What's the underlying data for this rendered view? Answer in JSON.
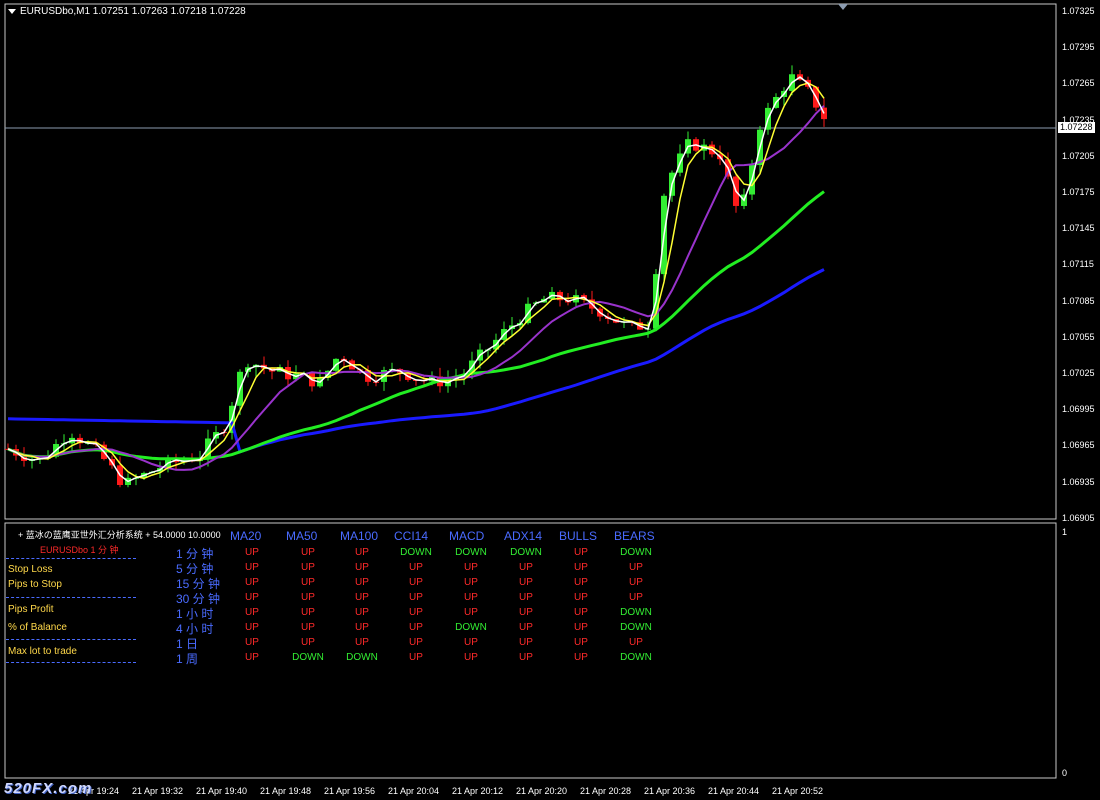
{
  "window": {
    "title": "EURUSDbo,M1  1.07251 1.07263 1.07218 1.07228",
    "current_price": "1.07228"
  },
  "price_axis": [
    "1.07325",
    "1.07295",
    "1.07265",
    "1.07235",
    "1.07205",
    "1.07175",
    "1.07145",
    "1.07115",
    "1.07085",
    "1.07055",
    "1.07025",
    "1.06995",
    "1.06965",
    "1.06935",
    "1.06905"
  ],
  "time_axis": [
    "21 Apr 19:24",
    "21 Apr 19:32",
    "21 Apr 19:40",
    "21 Apr 19:48",
    "21 Apr 19:56",
    "21 Apr 20:04",
    "21 Apr 20:12",
    "21 Apr 20:20",
    "21 Apr 20:28",
    "21 Apr 20:36",
    "21 Apr 20:44",
    "21 Apr 20:52"
  ],
  "indicator": {
    "title": "+ 蓝冰の蓝鹰亚世外汇分析系统 + 54.0000 10.0000",
    "axis_top": "1",
    "axis_bottom": "0",
    "symbol_label": "EURUSDbo  1 分 钟",
    "left_labels": [
      "Stop Loss",
      "Pips to Stop",
      "Pips Profit",
      "% of Balance",
      "Max lot to trade"
    ],
    "headers": [
      "MA20",
      "MA50",
      "MA100",
      "CCI14",
      "MACD",
      "ADX14",
      "BULLS",
      "BEARS"
    ],
    "rows": [
      {
        "tf": "1 分 钟",
        "vals": [
          "UP",
          "UP",
          "UP",
          "DOWN",
          "DOWN",
          "DOWN",
          "UP",
          "DOWN"
        ]
      },
      {
        "tf": "5 分 钟",
        "vals": [
          "UP",
          "UP",
          "UP",
          "UP",
          "UP",
          "UP",
          "UP",
          "UP"
        ]
      },
      {
        "tf": "15 分 钟",
        "vals": [
          "UP",
          "UP",
          "UP",
          "UP",
          "UP",
          "UP",
          "UP",
          "UP"
        ]
      },
      {
        "tf": "30 分 钟",
        "vals": [
          "UP",
          "UP",
          "UP",
          "UP",
          "UP",
          "UP",
          "UP",
          "UP"
        ]
      },
      {
        "tf": "1 小 时",
        "vals": [
          "UP",
          "UP",
          "UP",
          "UP",
          "UP",
          "UP",
          "UP",
          "DOWN"
        ]
      },
      {
        "tf": "4 小 时",
        "vals": [
          "UP",
          "UP",
          "UP",
          "UP",
          "DOWN",
          "UP",
          "UP",
          "DOWN"
        ]
      },
      {
        "tf": "1    日",
        "vals": [
          "UP",
          "UP",
          "UP",
          "UP",
          "UP",
          "UP",
          "UP",
          "UP"
        ]
      },
      {
        "tf": "1    周",
        "vals": [
          "UP",
          "DOWN",
          "DOWN",
          "UP",
          "UP",
          "UP",
          "UP",
          "DOWN"
        ]
      }
    ]
  },
  "colors": {
    "up": "#ff2a2a",
    "down": "#33ee33",
    "bull_candle": "#33ee33",
    "bear_candle": "#ff1a1a",
    "ma_white": "#ffffff",
    "ma_yellow": "#ffff33",
    "ma_purple": "#9933cc",
    "ma_green": "#22ee22",
    "ma_blue": "#1a1aff",
    "header_blue": "#4a6bff"
  },
  "watermark": "520FX.com"
}
